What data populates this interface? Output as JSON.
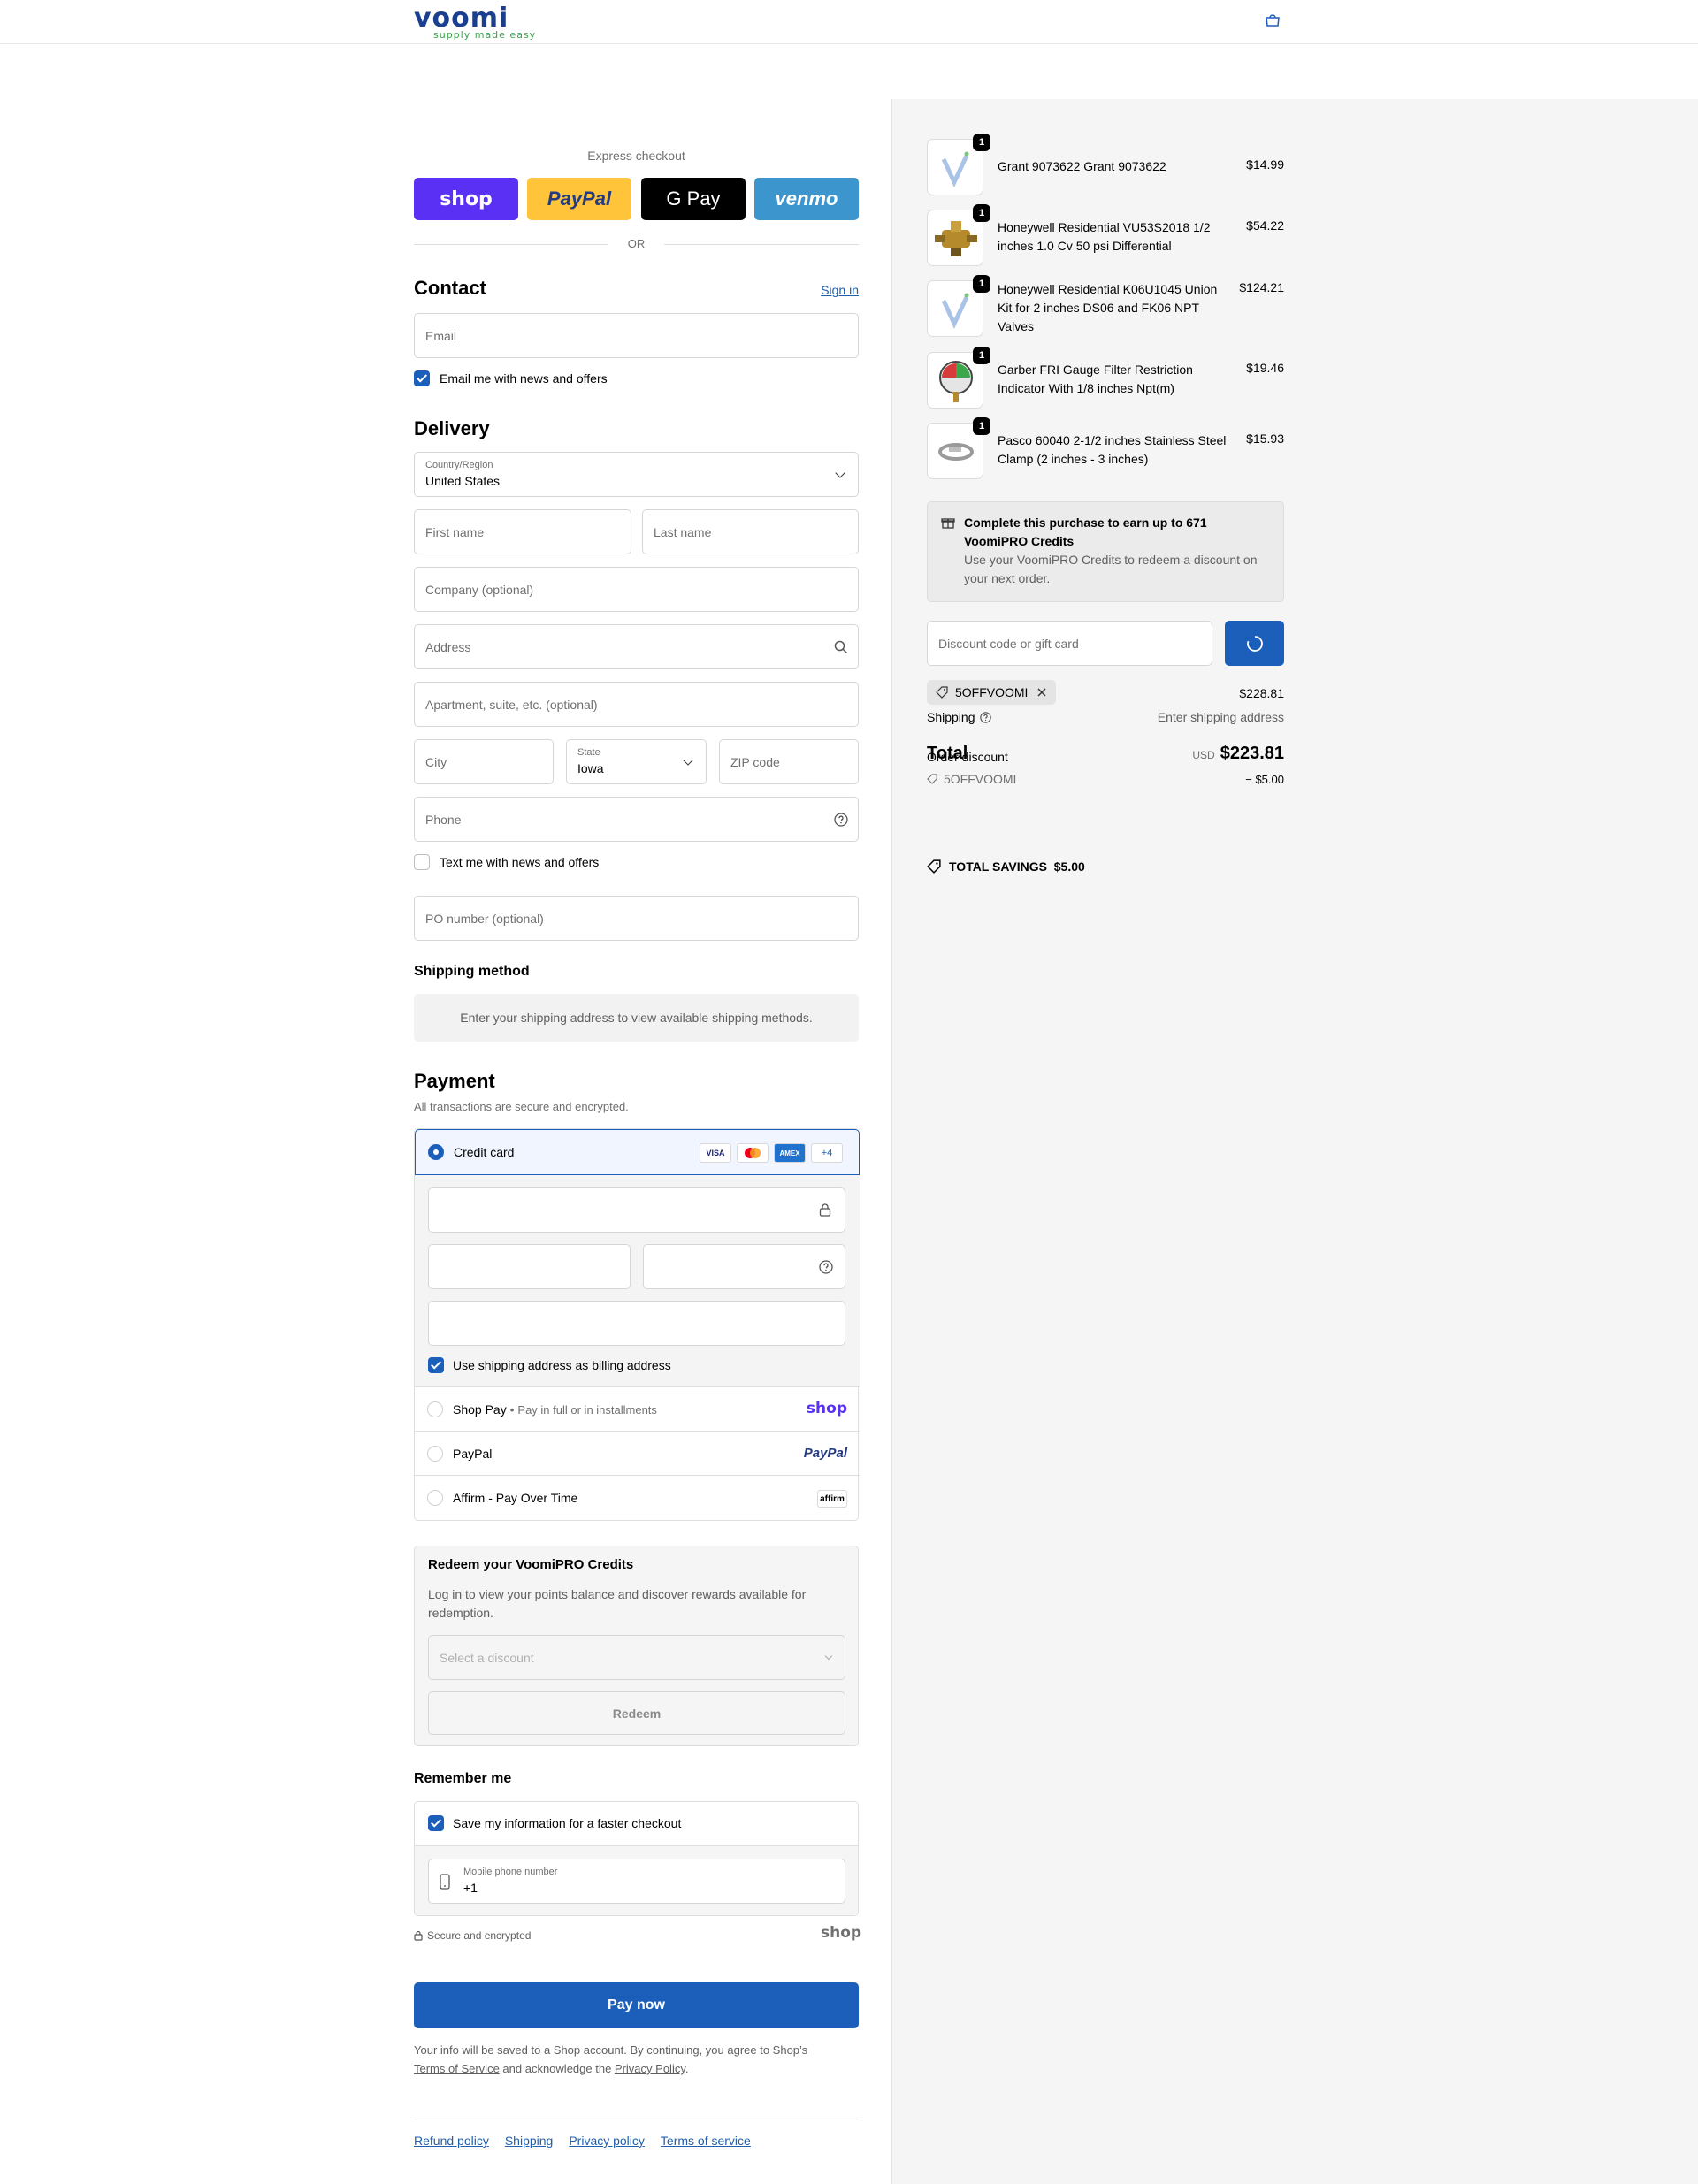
{
  "header": {
    "logo_main": "voomi",
    "logo_sub": "supply made easy",
    "bag_icon": "shopping-bag-icon"
  },
  "express": {
    "label": "Express checkout",
    "buttons": [
      "shop",
      "PayPal",
      "G Pay",
      "venmo"
    ],
    "or": "OR"
  },
  "contact": {
    "title": "Contact",
    "sign_in": "Sign in",
    "email_placeholder": "Email",
    "news_label": "Email me with news and offers"
  },
  "delivery": {
    "title": "Delivery",
    "country_label": "Country/Region",
    "country_value": "United States",
    "first_name": "First name",
    "last_name": "Last name",
    "company": "Company (optional)",
    "address": "Address",
    "apartment": "Apartment, suite, etc. (optional)",
    "city": "City",
    "state_label": "State",
    "state_value": "Iowa",
    "zip": "ZIP code",
    "phone": "Phone",
    "text_label": "Text me with news and offers",
    "po": "PO number (optional)"
  },
  "shipping_method": {
    "title": "Shipping method",
    "message": "Enter your shipping address to view available shipping methods."
  },
  "payment": {
    "title": "Payment",
    "subtitle": "All transactions are secure and encrypted.",
    "credit_card": "Credit card",
    "cards": [
      "VISA",
      "MC",
      "AMEX",
      "+4"
    ],
    "billing_label": "Use shipping address as billing address",
    "shop_pay": "Shop Pay",
    "shop_pay_sub": "Pay in full or in installments",
    "shop_pay_logo": "shop",
    "paypal": "PayPal",
    "paypal_logo": "PayPal",
    "affirm": "Affirm - Pay Over Time",
    "affirm_logo": "affirm"
  },
  "redeem": {
    "title": "Redeem your VoomiPRO Credits",
    "login": "Log in",
    "text": " to view your points balance and discover rewards available for redemption.",
    "select_placeholder": "Select a discount",
    "button": "Redeem"
  },
  "remember": {
    "title": "Remember me",
    "save_label": "Save my information for a faster checkout",
    "mobile_label": "Mobile phone number",
    "mobile_value": "+1",
    "secure": "Secure and encrypted",
    "shop_logo": "shop"
  },
  "pay_now": "Pay now",
  "legal": {
    "text1": "Your info will be saved to a Shop account. By continuing, you agree to Shop’s",
    "tos": "Terms of Service",
    "text2": " and acknowledge the ",
    "privacy": "Privacy Policy",
    "text3": "."
  },
  "footer_links": [
    "Refund policy",
    "Shipping",
    "Privacy policy",
    "Terms of service"
  ],
  "cart": {
    "items": [
      {
        "qty": "1",
        "name": "Grant 9073622 Grant 9073622",
        "price": "$14.99"
      },
      {
        "qty": "1",
        "name": "Honeywell Residential VU53S2018 1/2 inches 1.0 Cv 50 psi Differential",
        "price": "$54.22"
      },
      {
        "qty": "1",
        "name": "Honeywell Residential K06U1045 Union Kit for 2 inches DS06 and FK06 NPT Valves",
        "price": "$124.21"
      },
      {
        "qty": "1",
        "name": "Garber FRI Gauge Filter Restriction Indicator With 1/8 inches Npt(m)",
        "price": "$19.46"
      },
      {
        "qty": "1",
        "name": "Pasco 60040 2-1/2 inches Stainless Steel Clamp (2 inches - 3 inches)",
        "price": "$15.93"
      }
    ],
    "credits_title": "Complete this purchase to earn up to 671 VoomiPRO Credits",
    "credits_text": "Use your VoomiPRO Credits to redeem a discount on your next order.",
    "discount_placeholder": "Discount code or gift card",
    "code": "5OFFVOOMI",
    "subtotal_value": "$228.81",
    "shipping_label": "Shipping",
    "shipping_value": "Enter shipping address",
    "total_label": "Total",
    "order_discount_label": "Order discount",
    "currency": "USD",
    "total_value": "$223.81",
    "discount_code_line": "5OFFVOOMI",
    "discount_amount": "− $5.00",
    "savings_label": "TOTAL SAVINGS",
    "savings_value": "$5.00"
  }
}
